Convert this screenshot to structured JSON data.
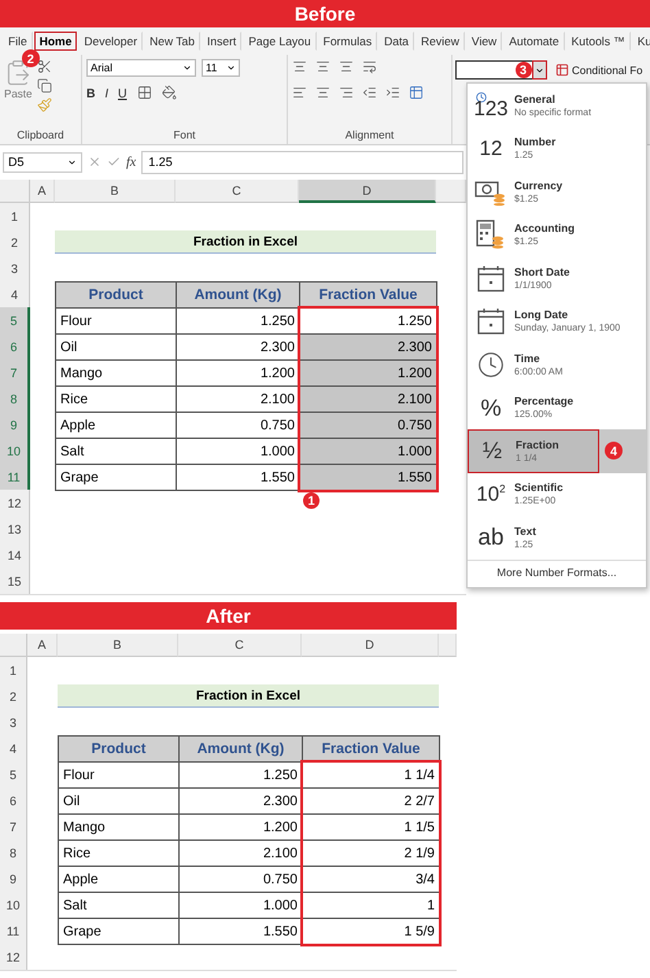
{
  "before_banner": "Before",
  "ribbon_tabs": [
    {
      "label": "File",
      "selected": false
    },
    {
      "label": "Home",
      "selected": true,
      "step": "2"
    },
    {
      "label": "Developer",
      "selected": false
    },
    {
      "label": "New Tab",
      "selected": false
    },
    {
      "label": "Insert",
      "selected": false
    },
    {
      "label": "Page Layou",
      "selected": false
    },
    {
      "label": "Formulas",
      "selected": false
    },
    {
      "label": "Data",
      "selected": false
    },
    {
      "label": "Review",
      "selected": false
    },
    {
      "label": "View",
      "selected": false
    },
    {
      "label": "Automate",
      "selected": false
    },
    {
      "label": "Kutools ™",
      "selected": false
    },
    {
      "label": "Ku",
      "selected": false
    }
  ],
  "ribbon": {
    "clipboard": {
      "paste": "Paste",
      "label": "Clipboard"
    },
    "font": {
      "name": "Arial",
      "size": "11",
      "styles": [
        "B",
        "I",
        "U"
      ],
      "label": "Font"
    },
    "alignment": {
      "label": "Alignment"
    },
    "number_format": {
      "step": "3"
    },
    "conditional_formatting": "Conditional Fo"
  },
  "formula_bar": {
    "cell": "D5",
    "fx": "fx",
    "value": "1.25"
  },
  "number_menu": {
    "items": [
      {
        "kind": "general",
        "glyph": "123",
        "name": "General",
        "sample": "No specific format",
        "selected": false
      },
      {
        "kind": "number",
        "glyph": "12",
        "name": "Number",
        "sample": "1.25",
        "selected": false
      },
      {
        "kind": "currency",
        "name": "Currency",
        "sample": "$1.25",
        "selected": false
      },
      {
        "kind": "accounting",
        "name": "Accounting",
        "sample": " $1.25",
        "selected": false
      },
      {
        "kind": "short_date",
        "name": "Short Date",
        "sample": "1/1/1900",
        "selected": false
      },
      {
        "kind": "long_date",
        "name": "Long Date",
        "sample": "Sunday, January 1, 1900",
        "selected": false
      },
      {
        "kind": "time",
        "name": "Time",
        "sample": "6:00:00 AM",
        "selected": false
      },
      {
        "kind": "percentage",
        "glyph": "%",
        "name": "Percentage",
        "sample": "125.00%",
        "selected": false
      },
      {
        "kind": "fraction",
        "glyph": "½",
        "name": "Fraction",
        "sample": "1 1/4",
        "selected": true,
        "step": "4"
      },
      {
        "kind": "scientific",
        "glyph": "10$^{2}$",
        "name": "Scientific",
        "sample": "1.25E+00",
        "selected": false
      },
      {
        "kind": "text",
        "glyph": "ab",
        "name": "Text",
        "sample": "1.25",
        "selected": false
      }
    ],
    "more": "More Number Formats..."
  },
  "sheet_before": {
    "columns": [
      {
        "label": "A",
        "selected": false
      },
      {
        "label": "B",
        "selected": false
      },
      {
        "label": "C",
        "selected": false
      },
      {
        "label": "D",
        "selected": true
      }
    ],
    "row_numbers": [
      {
        "label": "1",
        "selected": false
      },
      {
        "label": "2",
        "selected": false
      },
      {
        "label": "3",
        "selected": false
      },
      {
        "label": "4",
        "selected": false
      },
      {
        "label": "5",
        "selected": true
      },
      {
        "label": "6",
        "selected": true
      },
      {
        "label": "7",
        "selected": true
      },
      {
        "label": "8",
        "selected": true
      },
      {
        "label": "9",
        "selected": true
      },
      {
        "label": "10",
        "selected": true
      },
      {
        "label": "11",
        "selected": true
      },
      {
        "label": "12",
        "selected": false
      },
      {
        "label": "13",
        "selected": false
      },
      {
        "label": "14",
        "selected": false
      },
      {
        "label": "15",
        "selected": false
      }
    ],
    "title": "Fraction in Excel",
    "headers": [
      "Product",
      "Amount (Kg)",
      "Fraction Value"
    ],
    "rows": [
      {
        "product": "Flour",
        "amount": "1.250",
        "value": "1.250",
        "selected": false
      },
      {
        "product": "Oil",
        "amount": "2.300",
        "value": "2.300",
        "selected": true
      },
      {
        "product": "Mango",
        "amount": "1.200",
        "value": "1.200",
        "selected": true
      },
      {
        "product": "Rice",
        "amount": "2.100",
        "value": "2.100",
        "selected": true
      },
      {
        "product": "Apple",
        "amount": "0.750",
        "value": "0.750",
        "selected": true
      },
      {
        "product": "Salt",
        "amount": "1.000",
        "value": "1.000",
        "selected": true
      },
      {
        "product": "Grape",
        "amount": "1.550",
        "value": "1.550",
        "selected": true
      }
    ],
    "range_outline": true,
    "step": "1"
  },
  "after_banner": "After",
  "sheet_after": {
    "columns": [
      {
        "label": "A",
        "selected": false
      },
      {
        "label": "B",
        "selected": false
      },
      {
        "label": "C",
        "selected": false
      },
      {
        "label": "D",
        "selected": false
      }
    ],
    "row_numbers": [
      {
        "label": "1",
        "selected": false
      },
      {
        "label": "2",
        "selected": false
      },
      {
        "label": "3",
        "selected": false
      },
      {
        "label": "4",
        "selected": false
      },
      {
        "label": "5",
        "selected": false
      },
      {
        "label": "6",
        "selected": false
      },
      {
        "label": "7",
        "selected": false
      },
      {
        "label": "8",
        "selected": false
      },
      {
        "label": "9",
        "selected": false
      },
      {
        "label": "10",
        "selected": false
      },
      {
        "label": "11",
        "selected": false
      },
      {
        "label": "12",
        "selected": false
      }
    ],
    "title": "Fraction in Excel",
    "headers": [
      "Product",
      "Amount (Kg)",
      "Fraction Value"
    ],
    "rows": [
      {
        "product": "Flour",
        "amount": "1.250",
        "value": "1 1/4",
        "selected": false
      },
      {
        "product": "Oil",
        "amount": "2.300",
        "value": "2 2/7",
        "selected": false
      },
      {
        "product": "Mango",
        "amount": "1.200",
        "value": "1 1/5",
        "selected": false
      },
      {
        "product": "Rice",
        "amount": "2.100",
        "value": "2 1/9",
        "selected": false
      },
      {
        "product": "Apple",
        "amount": "0.750",
        "value": "3/4",
        "selected": false
      },
      {
        "product": "Salt",
        "amount": "1.000",
        "value": "1",
        "selected": false
      },
      {
        "product": "Grape",
        "amount": "1.550",
        "value": "1 5/9",
        "selected": false
      }
    ],
    "range_outline": true
  }
}
